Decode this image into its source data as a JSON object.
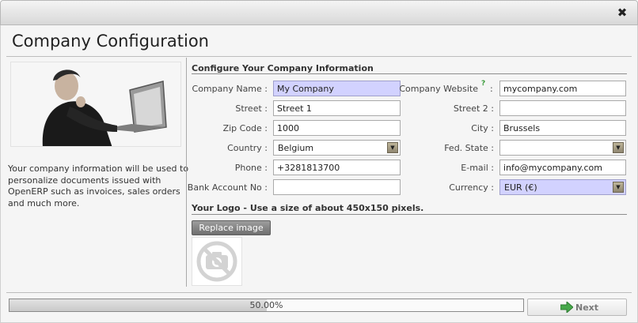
{
  "window": {
    "close_glyph": "✖"
  },
  "page": {
    "title": "Company Configuration"
  },
  "left": {
    "description": "Your company information will be used to personalize documents issued with OpenERP such as invoices, sales orders and much more."
  },
  "form": {
    "section_title": "Configure Your Company Information",
    "help_mark": "?",
    "fields": {
      "company_name": {
        "label": "Company Name :",
        "value": "My Company"
      },
      "street": {
        "label": "Street :",
        "value": "Street 1"
      },
      "zip": {
        "label": "Zip Code :",
        "value": "1000"
      },
      "country": {
        "label": "Country :",
        "value": "Belgium"
      },
      "phone": {
        "label": "Phone :",
        "value": "+3281813700"
      },
      "bank": {
        "label": "Bank Account No :",
        "value": ""
      },
      "website": {
        "label": "Company Website",
        "colon": ":",
        "value": "mycompany.com"
      },
      "street2": {
        "label": "Street 2 :",
        "value": ""
      },
      "city": {
        "label": "City :",
        "value": "Brussels"
      },
      "state": {
        "label": "Fed. State :",
        "value": ""
      },
      "email": {
        "label": "E-mail :",
        "value": "info@mycompany.com"
      },
      "currency": {
        "label": "Currency :",
        "value": "EUR (€)"
      }
    },
    "logo": {
      "title": "Your Logo - Use a size of about 450x150 pixels.",
      "replace_button": "Replace image"
    }
  },
  "footer": {
    "progress_text": "50.00%",
    "progress_value": 0.5,
    "next_button": "Next"
  },
  "colors": {
    "required_field": "#d2d2ff",
    "next_arrow": "#46a84a"
  }
}
